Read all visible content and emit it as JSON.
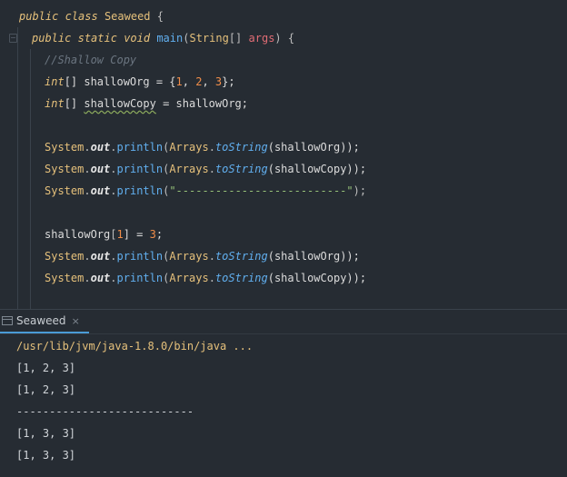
{
  "editor": {
    "class_decl": {
      "kw_public": "public",
      "kw_class": "class",
      "name": "Seaweed",
      "brace": " {"
    },
    "method_decl": {
      "kw_public": "public",
      "kw_static": "static",
      "kw_void": "void",
      "name": "main",
      "paren_open": "(",
      "type": "String",
      "brackets": "[] ",
      "param": "args",
      "paren_close": ") {"
    },
    "comment": "//Shallow Copy",
    "line_org": {
      "type": "int",
      "rest_a": "[] shallowOrg = {",
      "n1": "1",
      "c1": ", ",
      "n2": "2",
      "c2": ", ",
      "n3": "3",
      "end": "};"
    },
    "line_copy": {
      "type": "int",
      "brackets": "[] ",
      "var": "shallowCopy",
      "rest": " = shallowOrg;"
    },
    "print_org": {
      "cls": "System",
      "dot1": ".",
      "field": "out",
      "dot2": ".",
      "method": "println",
      "open": "(",
      "arr_cls": "Arrays",
      "dot3": ".",
      "arr_fn": "toString",
      "arg": "(shallowOrg));"
    },
    "print_copy": {
      "cls": "System",
      "dot1": ".",
      "field": "out",
      "dot2": ".",
      "method": "println",
      "open": "(",
      "arr_cls": "Arrays",
      "dot3": ".",
      "arr_fn": "toString",
      "arg": "(shallowCopy));"
    },
    "print_sep": {
      "cls": "System",
      "dot1": ".",
      "field": "out",
      "dot2": ".",
      "method": "println",
      "open": "(",
      "str": "\"--------------------------\"",
      "close": ");"
    },
    "assign": {
      "var": "shallowOrg",
      "open": "[",
      "idx": "1",
      "close": "] = ",
      "val": "3",
      "end": ";"
    },
    "print_org2": {
      "cls": "System",
      "dot1": ".",
      "field": "out",
      "dot2": ".",
      "method": "println",
      "open": "(",
      "arr_cls": "Arrays",
      "dot3": ".",
      "arr_fn": "toString",
      "arg": "(shallowOrg));"
    },
    "print_copy2": {
      "cls": "System",
      "dot1": ".",
      "field": "out",
      "dot2": ".",
      "method": "println",
      "open": "(",
      "arr_cls": "Arrays",
      "dot3": ".",
      "arr_fn": "toString",
      "arg": "(shallowCopy));"
    }
  },
  "run": {
    "tab_label": "Seaweed",
    "tab_close": "×",
    "output": [
      "/usr/lib/jvm/java-1.8.0/bin/java ...",
      "[1, 2, 3]",
      "[1, 2, 3]",
      "---------------------------",
      "[1, 3, 3]",
      "[1, 3, 3]"
    ]
  }
}
